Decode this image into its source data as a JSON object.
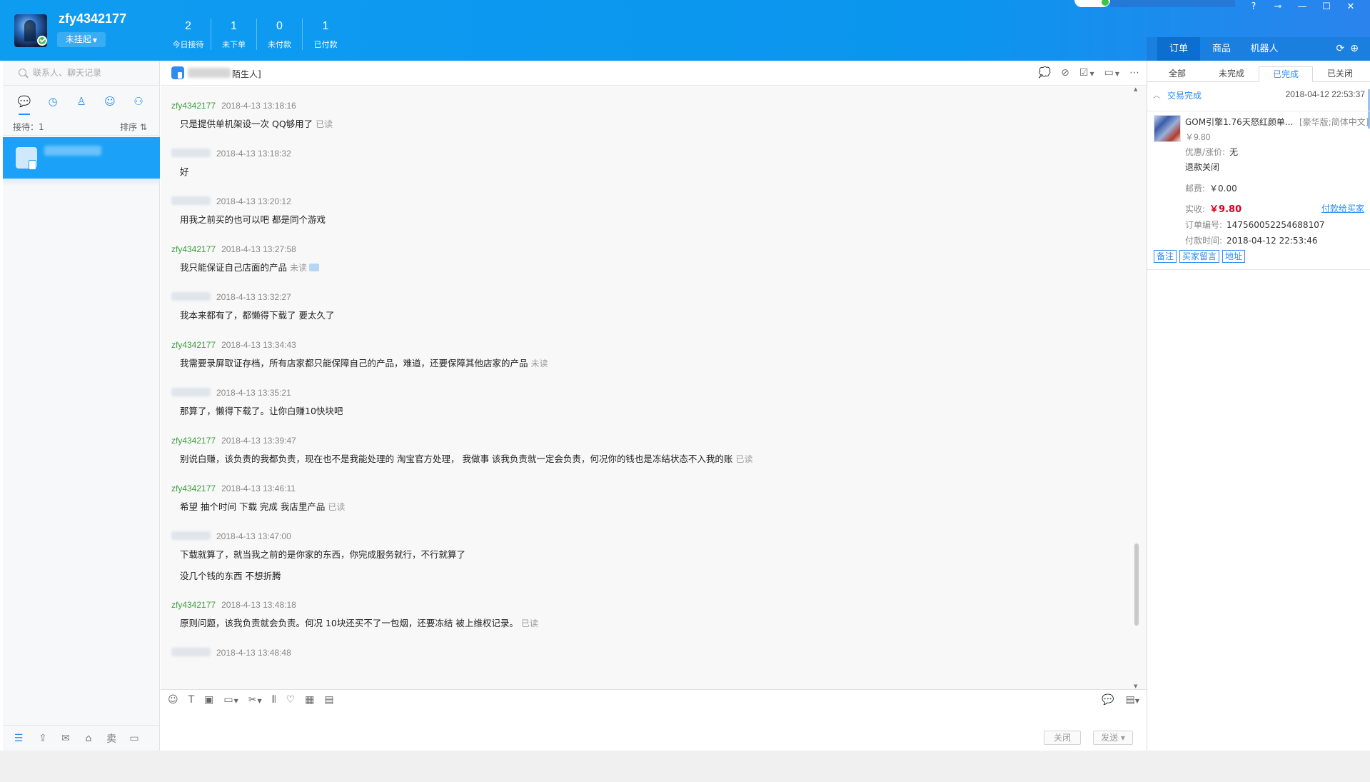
{
  "header": {
    "username": "zfy4342177",
    "status_button": "未挂起",
    "stats": [
      {
        "num": "2",
        "label": "今日接待"
      },
      {
        "num": "1",
        "label": "未下单"
      },
      {
        "num": "0",
        "label": "未付款"
      },
      {
        "num": "1",
        "label": "已付款"
      }
    ],
    "window_controls": [
      "?",
      "⊸",
      "—",
      "☐",
      "✕"
    ]
  },
  "sidebar": {
    "search_placeholder": "联系人、聊天记录",
    "nav_icons": [
      "chat-icon",
      "clock-icon",
      "person-icon",
      "group-icon",
      "org-icon"
    ],
    "reception_label": "接待：1",
    "sort_label": "排序 ⇅",
    "bottom_icons": [
      "menu-icon",
      "share-icon",
      "mail-icon",
      "store-icon",
      "sell-icon",
      "window-icon"
    ],
    "bottom_sell_label": "卖"
  },
  "chat": {
    "peer_tag": "陌生人]",
    "messages": [
      {
        "who": "seller",
        "name": "zfy4342177",
        "time": "2018-4-13 13:18:16",
        "text": "只是提供单机架设一次 QQ够用了",
        "status": "已读"
      },
      {
        "who": "buyer",
        "time": "2018-4-13 13:18:32",
        "text": "好"
      },
      {
        "who": "buyer",
        "time": "2018-4-13 13:20:12",
        "text": "用我之前买的也可以吧 都是同个游戏"
      },
      {
        "who": "seller",
        "name": "zfy4342177",
        "time": "2018-4-13 13:27:58",
        "text": "我只能保证自己店面的产品",
        "status": "未读"
      },
      {
        "who": "buyer",
        "time": "2018-4-13 13:32:27",
        "text": "我本来都有了，都懒得下载了 要太久了"
      },
      {
        "who": "seller",
        "name": "zfy4342177",
        "time": "2018-4-13 13:34:43",
        "text": "我需要录屏取证存档，所有店家都只能保障自己的产品，难道，还要保障其他店家的产品",
        "status": "未读"
      },
      {
        "who": "buyer",
        "time": "2018-4-13 13:35:21",
        "text": "那算了，懒得下载了。让你白赚10快块吧"
      },
      {
        "who": "seller",
        "name": "zfy4342177",
        "time": "2018-4-13 13:39:47",
        "text": "别说白赚，该负责的我都负责，现在也不是我能处理的 淘宝官方处理， 我做事 该我负责就一定会负责，何况你的钱也是冻结状态不入我的账",
        "status": "已读"
      },
      {
        "who": "seller",
        "name": "zfy4342177",
        "time": "2018-4-13 13:46:11",
        "text": "希望 抽个时间 下载 完成 我店里产品",
        "status": "已读"
      },
      {
        "who": "buyer",
        "time": "2018-4-13 13:47:00",
        "text": "下载就算了，就当我之前的是你家的东西，你完成服务就行，不行就算了",
        "text2": "没几个钱的东西 不想折腾"
      },
      {
        "who": "seller",
        "name": "zfy4342177",
        "time": "2018-4-13 13:48:18",
        "text": "原则问题，该我负责就会负责。何况 10块还买不了一包烟，还要冻结 被上维权记录。",
        "status": "已读"
      },
      {
        "who": "buyer",
        "time": "2018-4-13 13:48:48",
        "text": ""
      }
    ],
    "close_button": "关闭",
    "send_button": "发送 ▾"
  },
  "panel": {
    "top_tabs": [
      "订单",
      "商品",
      "机器人"
    ],
    "order_tabs": [
      "全部",
      "未完成",
      "已完成",
      "已关闭"
    ],
    "active_order_tab": "已完成",
    "status": "交易完成",
    "status_time": "2018-04-12 22:53:37",
    "product_title": "GOM引擎1.76天怒红颜单...",
    "product_spec": "[豪华版;简体中文]",
    "product_price": "￥9.80",
    "discount_label": "优惠/涨价:",
    "discount_value": "无",
    "refund_status": "退款关闭",
    "postage_label": "邮费:",
    "postage_value": "￥0.00",
    "paid_label": "实收:",
    "paid_value": "￥9.80",
    "pay_link": "付款给买家",
    "order_no_label": "订单编号:",
    "order_no": "147560052254688107",
    "pay_time_label": "付款时间:",
    "pay_time": "2018-04-12 22:53:46",
    "action_buttons": [
      "备注",
      "买家留言",
      "地址"
    ]
  },
  "colors": {
    "header_blue": "#0e9cf1",
    "accent": "#2d8cf0",
    "seller_name": "#3c9e3c",
    "price_red": "#d9001b"
  }
}
